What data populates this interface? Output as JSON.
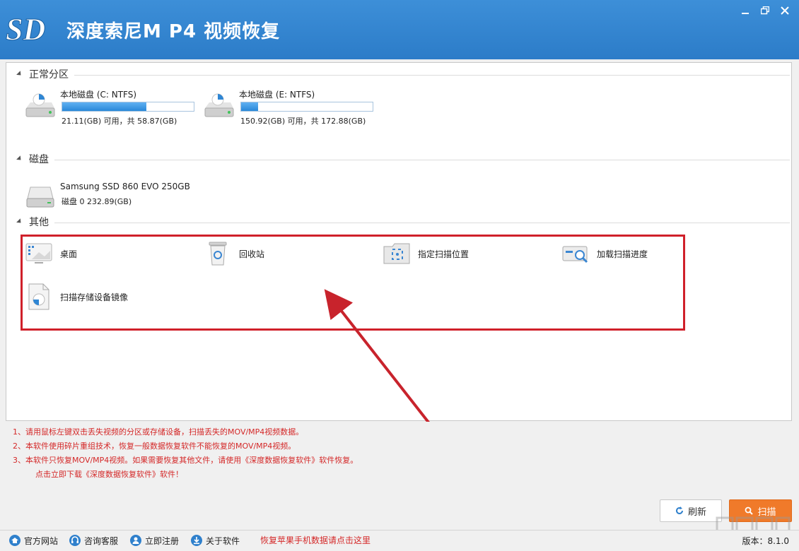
{
  "app": {
    "title": "深度索尼M P4 视频恢复",
    "logo_text": "SD",
    "accent_color": "#2f80cc"
  },
  "window_controls": [
    {
      "name": "minimize-button",
      "icon": "minimize-icon"
    },
    {
      "name": "restore-button",
      "icon": "restore-icon"
    },
    {
      "name": "close-button",
      "icon": "close-icon"
    }
  ],
  "sections": {
    "partitions": {
      "title": "正常分区"
    },
    "disks": {
      "title": "磁盘"
    },
    "others": {
      "title": "其他"
    }
  },
  "partitions": [
    {
      "name": "本地磁盘 (C: NTFS)",
      "info": "21.11(GB) 可用，共 58.87(GB)",
      "used_fraction": 0.64
    },
    {
      "name": "本地磁盘 (E: NTFS)",
      "info": "150.92(GB) 可用，共 172.88(GB)",
      "used_fraction": 0.13
    }
  ],
  "disks": [
    {
      "name": "Samsung SSD 860 EVO 250GB",
      "info": "磁盘 0    232.89(GB)"
    }
  ],
  "others": [
    {
      "label": "桌面",
      "icon": "desktop-icon"
    },
    {
      "label": "回收站",
      "icon": "recycle-bin-icon"
    },
    {
      "label": "指定扫描位置",
      "icon": "scan-location-icon"
    },
    {
      "label": "加载扫描进度",
      "icon": "load-progress-icon"
    },
    {
      "label": "扫描存储设备镜像",
      "icon": "disk-image-icon"
    }
  ],
  "notes": [
    "1、请用鼠标左键双击丢失视频的分区或存储设备，扫描丢失的MOV/MP4视频数据。",
    "2、本软件使用碎片重组技术，恢复一般数据恢复软件不能恢复的MOV/MP4视频。",
    "3、本软件只恢复MOV/MP4视频。如果需要恢复其他文件，请使用《深度数据恢复软件》软件恢复。",
    "点击立即下载《深度数据恢复软件》软件！"
  ],
  "buttons": {
    "refresh": "刷新",
    "scan": "扫描"
  },
  "statusbar": {
    "items": [
      {
        "label": "官方网站",
        "icon": "home-icon"
      },
      {
        "label": "咨询客服",
        "icon": "support-icon"
      },
      {
        "label": "立即注册",
        "icon": "register-icon"
      },
      {
        "label": "关于软件",
        "icon": "about-icon"
      }
    ],
    "link": "恢复苹果手机数据请点击这里",
    "version": "版本：8.1.0"
  }
}
